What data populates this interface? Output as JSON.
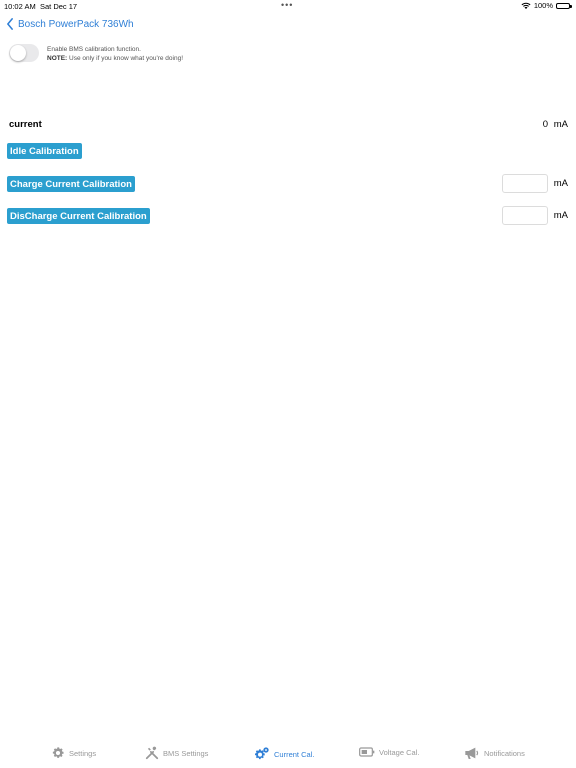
{
  "status_bar": {
    "time": "10:02 AM",
    "date": "Sat Dec 17",
    "dots": "•••",
    "battery": "100%"
  },
  "nav": {
    "back_label": "Bosch PowerPack 736Wh"
  },
  "bms_toggle": {
    "enabled": false,
    "text": "Enable BMS calibration function.",
    "note_label": "NOTE:",
    "note_text": " Use only if you know what you're doing!"
  },
  "current": {
    "label": "current",
    "value": "0",
    "unit": "mA"
  },
  "buttons": {
    "idle": "Idle Calibration",
    "charge": "Charge Current Calibration",
    "discharge": "DisCharge Current Calibration"
  },
  "inputs": {
    "charge_value": "",
    "charge_unit": "mA",
    "discharge_value": "",
    "discharge_unit": "mA"
  },
  "tabs": [
    {
      "label": "Settings",
      "icon": "gear-icon",
      "active": false
    },
    {
      "label": "BMS Settings",
      "icon": "tools-icon",
      "active": false
    },
    {
      "label": "Current Cal.",
      "icon": "gears-icon",
      "active": true
    },
    {
      "label": "Voltage Cal.",
      "icon": "battery-icon",
      "active": false
    },
    {
      "label": "Notifications",
      "icon": "megaphone-icon",
      "active": false
    }
  ],
  "colors": {
    "accent": "#2f7fd6",
    "button": "#2b9fcf",
    "inactive_tab": "#999999"
  }
}
